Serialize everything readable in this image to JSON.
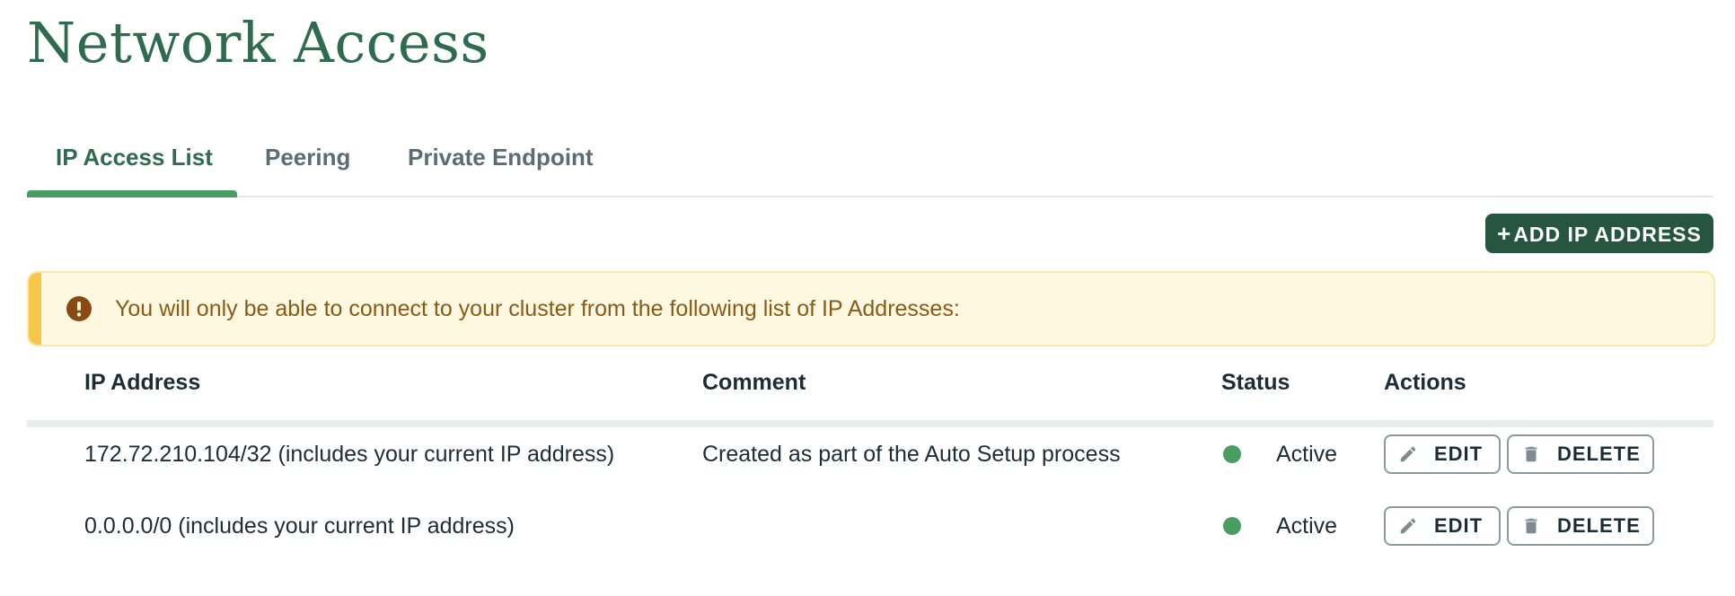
{
  "page": {
    "title": "Network Access"
  },
  "tabs": [
    {
      "label": "IP Access List",
      "active": true
    },
    {
      "label": "Peering",
      "active": false
    },
    {
      "label": "Private Endpoint",
      "active": false
    }
  ],
  "toolbar": {
    "add_button_plus": "+",
    "add_button_label": "ADD IP ADDRESS"
  },
  "banner": {
    "icon": "exclamation-circle-icon",
    "text": "You will only be able to connect to your cluster from the following list of IP Addresses:"
  },
  "table": {
    "headers": {
      "ip": "IP Address",
      "comment": "Comment",
      "status": "Status",
      "actions": "Actions"
    },
    "rows": [
      {
        "ip": "172.72.210.104/32",
        "ip_note": "(includes your current IP address)",
        "comment": "Created as part of the Auto Setup process",
        "status": "Active",
        "edit_label": "EDIT",
        "delete_label": "DELETE"
      },
      {
        "ip": "0.0.0.0/0",
        "ip_note": "(includes your current IP address)",
        "comment": "",
        "status": "Active",
        "edit_label": "EDIT",
        "delete_label": "DELETE"
      }
    ]
  },
  "colors": {
    "brand_green": "#2f6b4f",
    "button_green": "#265641",
    "status_active": "#4a9d62",
    "warning_bg": "#fdf8df",
    "warning_text": "#8a5a17"
  }
}
